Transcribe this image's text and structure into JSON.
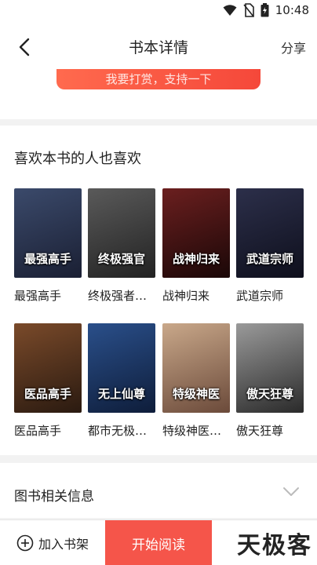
{
  "status": {
    "time": "10:48",
    "icons": [
      "wifi-icon",
      "no-sim-icon",
      "battery-icon"
    ]
  },
  "nav": {
    "back_icon": "chevron-left-icon",
    "title": "书本详情",
    "share": "分享"
  },
  "reward_button": "我要打赏，支持一下",
  "recommendations": {
    "heading": "喜欢本书的人也喜欢",
    "books": [
      {
        "name": "最强高手",
        "cover_text": "最强高手",
        "colors": [
          "#3b4a6b",
          "#1a1f33"
        ]
      },
      {
        "name": "终极强者…",
        "cover_text": "终极强官",
        "colors": [
          "#5a5a5a",
          "#222"
        ]
      },
      {
        "name": "战神归来",
        "cover_text": "战神归来",
        "colors": [
          "#6b1f1f",
          "#1a0707"
        ]
      },
      {
        "name": "武道宗师",
        "cover_text": "武道宗师",
        "colors": [
          "#2c2f4a",
          "#0e0f1c"
        ]
      },
      {
        "name": "医品高手",
        "cover_text": "医品高手",
        "colors": [
          "#7a4a2a",
          "#2a1a10"
        ]
      },
      {
        "name": "都市无极…",
        "cover_text": "无上仙尊",
        "colors": [
          "#2a4f8a",
          "#0e1d3a"
        ]
      },
      {
        "name": "特级神医…",
        "cover_text": "特级神医",
        "colors": [
          "#c9a88a",
          "#6b4a3a"
        ]
      },
      {
        "name": "傲天狂尊",
        "cover_text": "傲天狂尊",
        "colors": [
          "#9a9a9a",
          "#2a2a2a"
        ]
      }
    ]
  },
  "book_info": {
    "label": "图书相关信息",
    "chevron_icon": "chevron-down-icon"
  },
  "bottom_bar": {
    "add_shelf": "加入书架",
    "start_reading": "开始阅读",
    "download": ""
  },
  "watermark": "天极客",
  "colors": {
    "accent": "#f5554a"
  }
}
